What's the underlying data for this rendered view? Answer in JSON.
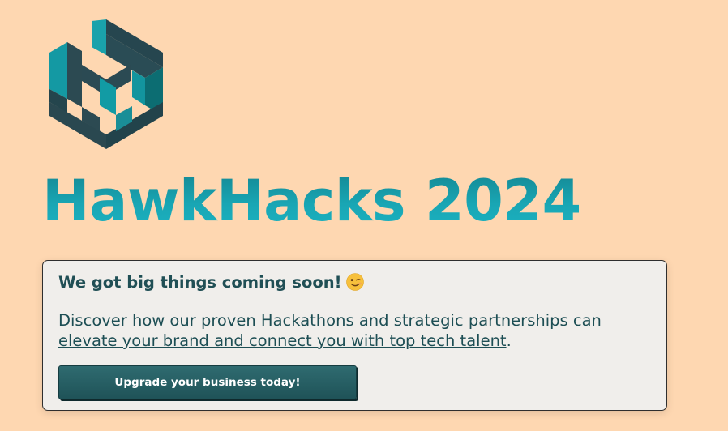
{
  "brand": {
    "logo_icon": "hawkhacks-logo-icon",
    "title": "HawkHacks 2024"
  },
  "card": {
    "headline": "We got big things coming soon!",
    "emoji_icon": "winking-face-icon",
    "paragraph_text": "Discover how our proven Hackathons and strategic partnerships can",
    "paragraph_link": "elevate your brand and connect you with top tech talent",
    "paragraph_end": ".",
    "cta_label": "Upgrade your business today!"
  },
  "colors": {
    "background": "#fed7b1",
    "title_teal": "#19a6b4",
    "dark_teal": "#204f55",
    "card_bg": "#f0eeeb"
  }
}
